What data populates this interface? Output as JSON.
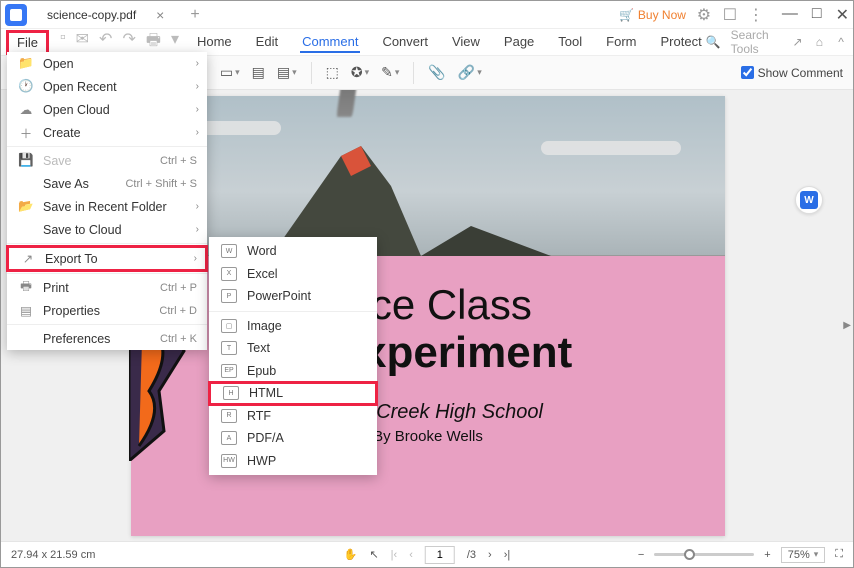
{
  "tab": {
    "title": "science-copy.pdf"
  },
  "titlebar": {
    "buy_now": "Buy Now"
  },
  "menubar": {
    "file": "File",
    "tabs": [
      "Home",
      "Edit",
      "Comment",
      "Convert",
      "View",
      "Page",
      "Tool",
      "Form",
      "Protect"
    ],
    "active_tab": "Comment",
    "search_placeholder": "Search Tools"
  },
  "ribbon": {
    "show_comment": "Show Comment"
  },
  "file_menu": {
    "items": [
      {
        "label": "Open",
        "icon": "folder",
        "chev": true
      },
      {
        "label": "Open Recent",
        "icon": "clock",
        "chev": true
      },
      {
        "label": "Open Cloud",
        "icon": "cloud",
        "chev": true
      },
      {
        "label": "Create",
        "icon": "plus",
        "chev": true
      },
      {
        "sep": true
      },
      {
        "label": "Save",
        "icon": "save",
        "shortcut": "Ctrl + S",
        "disabled": true
      },
      {
        "label": "Save As",
        "icon": "",
        "shortcut": "Ctrl + Shift + S"
      },
      {
        "label": "Save in Recent Folder",
        "icon": "folder-open",
        "chev": true
      },
      {
        "label": "Save to Cloud",
        "icon": "",
        "chev": true
      },
      {
        "sep": true
      },
      {
        "label": "Export To",
        "icon": "export",
        "chev": true,
        "highlighted": true
      },
      {
        "sep": true
      },
      {
        "label": "Print",
        "icon": "print",
        "shortcut": "Ctrl + P"
      },
      {
        "label": "Properties",
        "icon": "props",
        "shortcut": "Ctrl + D"
      },
      {
        "sep": true
      },
      {
        "label": "Preferences",
        "icon": "",
        "shortcut": "Ctrl + K"
      }
    ]
  },
  "export_submenu": {
    "items": [
      {
        "label": "Word",
        "icon": "W"
      },
      {
        "label": "Excel",
        "icon": "X"
      },
      {
        "label": "PowerPoint",
        "icon": "P"
      },
      {
        "sep": true
      },
      {
        "label": "Image",
        "icon": "▢"
      },
      {
        "label": "Text",
        "icon": "T"
      },
      {
        "label": "Epub",
        "icon": "EP"
      },
      {
        "label": "HTML",
        "icon": "H",
        "highlighted": true
      },
      {
        "label": "RTF",
        "icon": "R"
      },
      {
        "label": "PDF/A",
        "icon": "A"
      },
      {
        "label": "HWP",
        "icon": "HW"
      }
    ]
  },
  "document": {
    "title_line1": "ence Class",
    "title_line2": "ic Experiment",
    "school": "Willow Creek High School",
    "author": "By Brooke Wells"
  },
  "statusbar": {
    "dimensions": "27.94 x 21.59 cm",
    "page_current": "1",
    "page_total": "3",
    "zoom": "75%"
  }
}
